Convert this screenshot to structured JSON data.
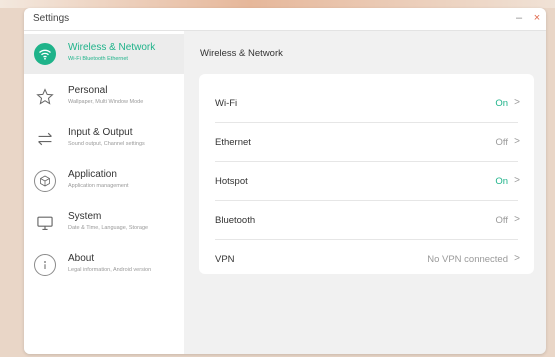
{
  "window": {
    "title": "Settings",
    "minimize_glyph": "–",
    "close_glyph": "×"
  },
  "colors": {
    "accent": "#1fb38a",
    "close": "#e0674a"
  },
  "sidebar": {
    "items": [
      {
        "label": "Wireless & Network",
        "sub": "Wi-Fi Bluetooth Ethernet",
        "icon": "wifi-icon",
        "active": true
      },
      {
        "label": "Personal",
        "sub": "Wallpaper, Multi Window Mode",
        "icon": "star-icon",
        "active": false
      },
      {
        "label": "Input & Output",
        "sub": "Sound output, Channel settings",
        "icon": "swap-arrows-icon",
        "active": false
      },
      {
        "label": "Application",
        "sub": "Application management",
        "icon": "cube-icon",
        "active": false
      },
      {
        "label": "System",
        "sub": "Date & Time, Language, Storage",
        "icon": "monitor-icon",
        "active": false
      },
      {
        "label": "About",
        "sub": "Legal information, Android version",
        "icon": "info-icon",
        "active": false
      }
    ]
  },
  "main": {
    "title": "Wireless & Network",
    "rows": [
      {
        "label": "Wi-Fi",
        "value": "On",
        "on": true
      },
      {
        "label": "Ethernet",
        "value": "Off",
        "on": false
      },
      {
        "label": "Hotspot",
        "value": "On",
        "on": true
      },
      {
        "label": "Bluetooth",
        "value": "Off",
        "on": false
      },
      {
        "label": "VPN",
        "value": "No VPN connected",
        "on": false
      }
    ],
    "chevron": ">"
  }
}
